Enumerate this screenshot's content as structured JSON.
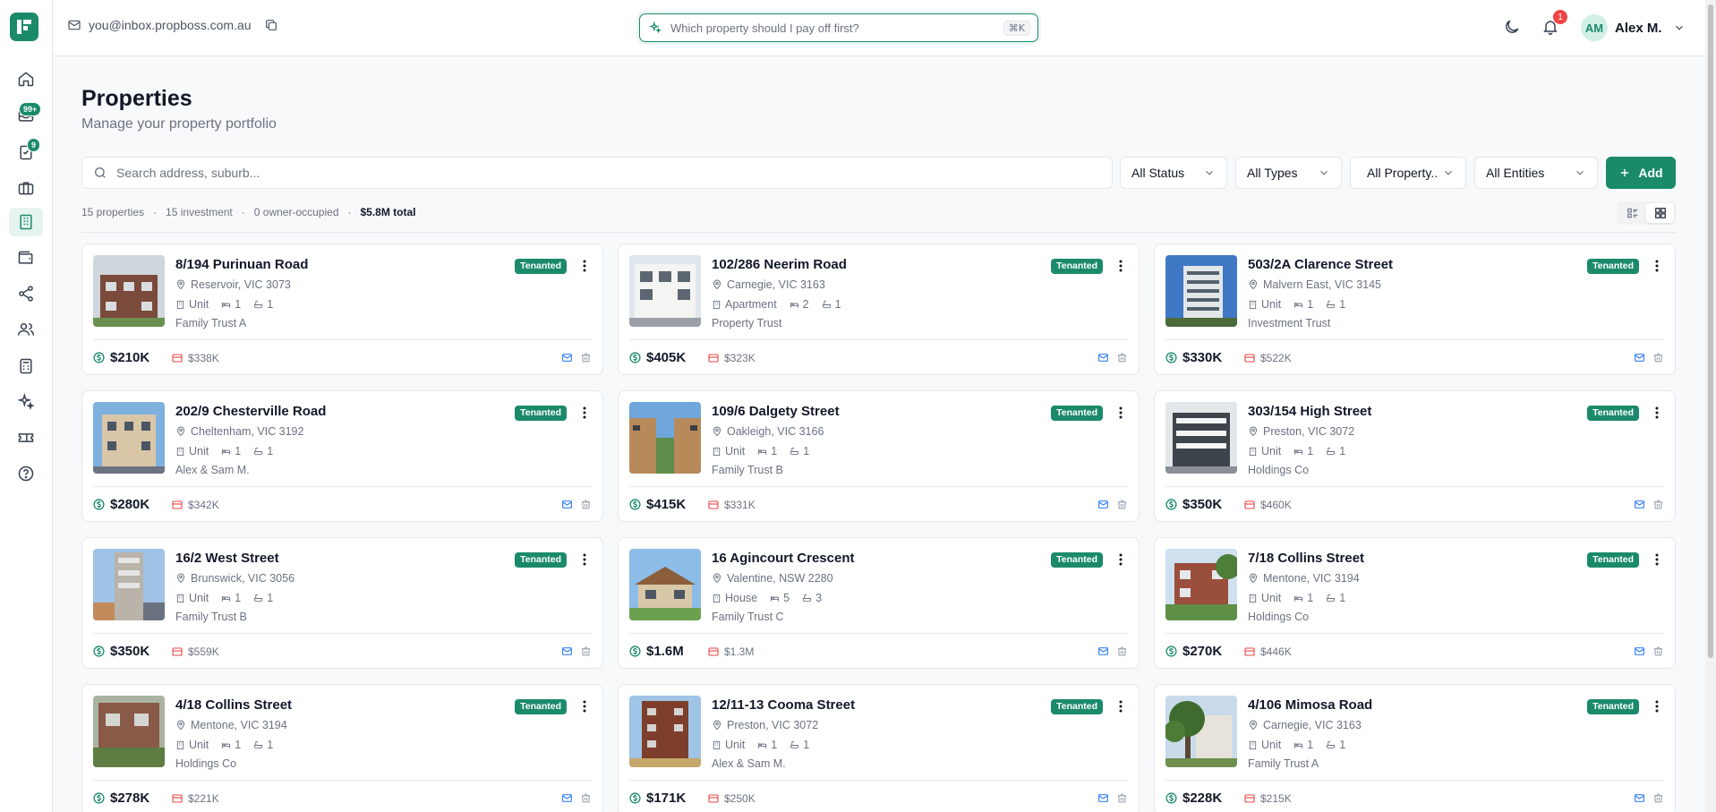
{
  "header": {
    "email": "you@inbox.propboss.com.au",
    "ai_search_placeholder": "Which property should I pay off first?",
    "ai_search_shortcut": "⌘K",
    "notification_count": "1",
    "user_initials": "AM",
    "user_name": "Alex M."
  },
  "sidebar": {
    "inbox_badge": "99+",
    "tasks_badge": "9",
    "items": [
      "home-icon",
      "inbox-icon",
      "tasks-icon",
      "briefcase-icon",
      "properties-icon",
      "wallet-icon",
      "share-icon",
      "users-icon",
      "calculator-icon",
      "sparkles-icon",
      "tickets-icon",
      "help-icon"
    ],
    "active": "properties-icon"
  },
  "page": {
    "title": "Properties",
    "subtitle": "Manage your property portfolio"
  },
  "filters": {
    "search_placeholder": "Search address, suburb...",
    "status": "All Status",
    "types": "All Types",
    "property": "All Property..",
    "entities": "All Entities",
    "add_label": "Add"
  },
  "stats": {
    "properties": "15 properties",
    "investment": "15 investment",
    "owner_occupied": "0 owner-occupied",
    "total": "$5.8M total"
  },
  "colors": {
    "accent": "#1b8a6b",
    "loan": "#ef4444"
  },
  "properties": [
    {
      "address": "8/194 Purinuan Road",
      "location": "Reservoir, VIC 3073",
      "type": "Unit",
      "beds": "1",
      "baths": "1",
      "entity": "Family Trust A",
      "status": "Tenanted",
      "value": "$210K",
      "loan": "$338K",
      "thumb": "brick"
    },
    {
      "address": "102/286 Neerim Road",
      "location": "Carnegie, VIC 3163",
      "type": "Apartment",
      "beds": "2",
      "baths": "1",
      "entity": "Property Trust",
      "status": "Tenanted",
      "value": "$405K",
      "loan": "$323K",
      "thumb": "white"
    },
    {
      "address": "503/2A Clarence Street",
      "location": "Malvern East, VIC 3145",
      "type": "Unit",
      "beds": "1",
      "baths": "1",
      "entity": "Investment Trust",
      "status": "Tenanted",
      "value": "$330K",
      "loan": "$522K",
      "thumb": "tower"
    },
    {
      "address": "202/9 Chesterville Road",
      "location": "Cheltenham, VIC 3192",
      "type": "Unit",
      "beds": "1",
      "baths": "1",
      "entity": "Alex & Sam M.",
      "status": "Tenanted",
      "value": "$280K",
      "loan": "$342K",
      "thumb": "beige"
    },
    {
      "address": "109/6 Dalgety Street",
      "location": "Oakleigh, VIC 3166",
      "type": "Unit",
      "beds": "1",
      "baths": "1",
      "entity": "Family Trust B",
      "status": "Tenanted",
      "value": "$415K",
      "loan": "$331K",
      "thumb": "lane"
    },
    {
      "address": "303/154 High Street",
      "location": "Preston, VIC 3072",
      "type": "Unit",
      "beds": "1",
      "baths": "1",
      "entity": "Holdings Co",
      "status": "Tenanted",
      "value": "$350K",
      "loan": "$460K",
      "thumb": "grey"
    },
    {
      "address": "16/2 West Street",
      "location": "Brunswick, VIC 3056",
      "type": "Unit",
      "beds": "1",
      "baths": "1",
      "entity": "Family Trust B",
      "status": "Tenanted",
      "value": "$350K",
      "loan": "$559K",
      "thumb": "modern"
    },
    {
      "address": "16 Agincourt Crescent",
      "location": "Valentine, NSW 2280",
      "type": "House",
      "beds": "5",
      "baths": "3",
      "entity": "Family Trust C",
      "status": "Tenanted",
      "value": "$1.6M",
      "loan": "$1.3M",
      "thumb": "house"
    },
    {
      "address": "7/18 Collins Street",
      "location": "Mentone, VIC 3194",
      "type": "Unit",
      "beds": "1",
      "baths": "1",
      "entity": "Holdings Co",
      "status": "Tenanted",
      "value": "$270K",
      "loan": "$446K",
      "thumb": "redbrick"
    },
    {
      "address": "4/18 Collins Street",
      "location": "Mentone, VIC 3194",
      "type": "Unit",
      "beds": "1",
      "baths": "1",
      "entity": "Holdings Co",
      "status": "Tenanted",
      "value": "$278K",
      "loan": "$221K",
      "thumb": "ivy"
    },
    {
      "address": "12/11-13 Cooma Street",
      "location": "Preston, VIC 3072",
      "type": "Unit",
      "beds": "1",
      "baths": "1",
      "entity": "Alex & Sam M.",
      "status": "Tenanted",
      "value": "$171K",
      "loan": "$250K",
      "thumb": "flats"
    },
    {
      "address": "4/106 Mimosa Road",
      "location": "Carnegie, VIC 3163",
      "type": "Unit",
      "beds": "1",
      "baths": "1",
      "entity": "Family Trust A",
      "status": "Tenanted",
      "value": "$228K",
      "loan": "$215K",
      "thumb": "tree"
    }
  ]
}
